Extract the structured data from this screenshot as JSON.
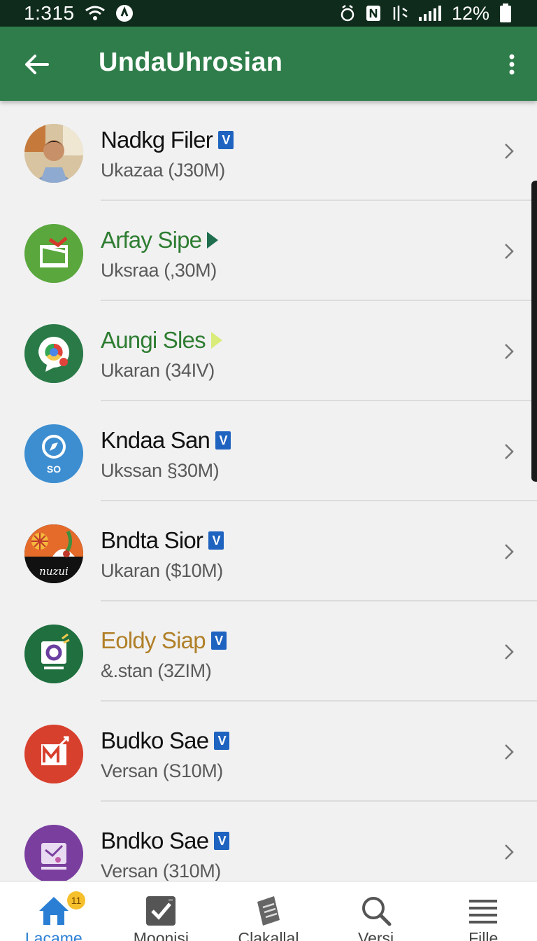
{
  "status_bar": {
    "time": "1:315",
    "battery_percent": "12%",
    "icons": [
      "wifi-icon",
      "notification-icon",
      "alarm-icon",
      "nfc-icon",
      "vibrate-icon",
      "signal-icon",
      "battery-icon"
    ]
  },
  "app_bar": {
    "title": "UndaUhrosian",
    "back_icon": "arrow-left-icon",
    "more_icon": "more-vertical-icon",
    "color": "#2e7d4a"
  },
  "list": {
    "items": [
      {
        "name": "Nadkg Filer",
        "subtitle": "Ukazaa (J30M)",
        "name_color": "#111111",
        "badge": "verified",
        "badge_text": "V",
        "avatar": "profile-photo"
      },
      {
        "name": "Arfay Sipe",
        "subtitle": "Uksraa (,30M)",
        "name_color": "#2e7d32",
        "badge": "arrow",
        "avatar": "green-gift-icon"
      },
      {
        "name": "Aungi Sles",
        "subtitle": "Ukaran (34IV)",
        "name_color": "#2e7d32",
        "badge": "arrow-light",
        "avatar": "chrome-bubble-icon"
      },
      {
        "name": "Kndaa San",
        "subtitle": "Ukssan §30M)",
        "name_color": "#111111",
        "badge": "verified",
        "badge_text": "V",
        "avatar": "compass-so-icon",
        "avatar_text": "SO"
      },
      {
        "name": "Bndta Sior",
        "subtitle": "Ukaran ($10M)",
        "name_color": "#111111",
        "badge": "verified",
        "badge_text": "V",
        "avatar": "art-nuzui-icon",
        "avatar_text": "nuzui"
      },
      {
        "name": "Eoldy Siap",
        "subtitle": "&.stan (3ZIM)",
        "name_color": "#b08028",
        "badge": "verified",
        "badge_text": "V",
        "avatar": "green-screen-icon"
      },
      {
        "name": "Budko Sae",
        "subtitle": "Versan (S10M)",
        "name_color": "#111111",
        "badge": "verified",
        "badge_text": "V",
        "avatar": "red-gmail-icon"
      },
      {
        "name": "Bndko Sae",
        "subtitle": "Versan (310M)",
        "name_color": "#111111",
        "badge": "verified",
        "badge_text": "V",
        "avatar": "purple-mail-icon"
      }
    ],
    "chevron_icon": "chevron-right-icon"
  },
  "bottom_nav": {
    "items": [
      {
        "label": "Lacame",
        "icon": "home-icon",
        "badge": "11",
        "active": true
      },
      {
        "label": "Moonisi",
        "icon": "checkbox-icon",
        "active": false
      },
      {
        "label": "Clakallal",
        "icon": "notes-icon",
        "active": false
      },
      {
        "label": "Versi",
        "icon": "search-icon",
        "active": false
      },
      {
        "label": "Fille",
        "icon": "menu-icon",
        "active": false
      }
    ]
  }
}
